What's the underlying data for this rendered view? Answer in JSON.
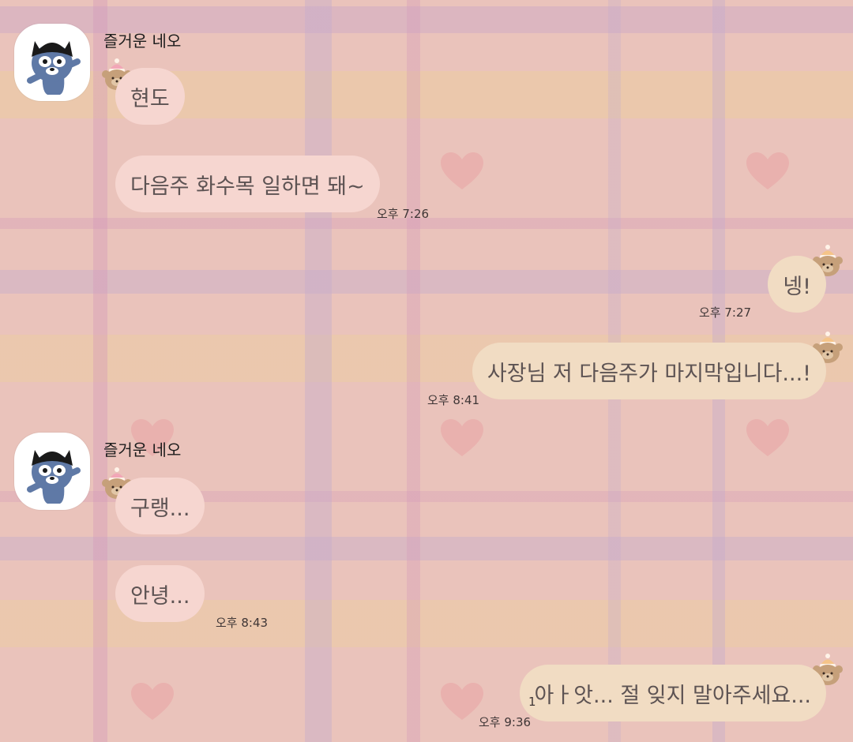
{
  "theme": {
    "incoming_bubble_color": "#f6d6d0",
    "outgoing_bubble_color": "#f1dcc3",
    "text_color": "#5d5353",
    "background_color": "#eac3bb"
  },
  "messages": [
    {
      "sender": "즐거운 네오",
      "direction": "incoming",
      "avatar_icon": "neo-cat-avatar-icon",
      "texts": [
        "현도",
        "다음주 화수목 일하면 돼~"
      ],
      "time": "오후 7:26"
    },
    {
      "direction": "outgoing",
      "texts": [
        "넹!"
      ],
      "time": "오후 7:27"
    },
    {
      "direction": "outgoing",
      "texts": [
        "사장님 저 다음주가 마지막입니다...!"
      ],
      "time": "오후 8:41"
    },
    {
      "sender": "즐거운 네오",
      "direction": "incoming",
      "avatar_icon": "neo-cat-avatar-icon",
      "texts": [
        "구랭...",
        "안녕..."
      ],
      "time": "오후 8:43"
    },
    {
      "direction": "outgoing",
      "texts": [
        "아ㅏ앗... 절 잊지 말아주세요..."
      ],
      "time": "오후 9:36",
      "unread": "1"
    }
  ]
}
